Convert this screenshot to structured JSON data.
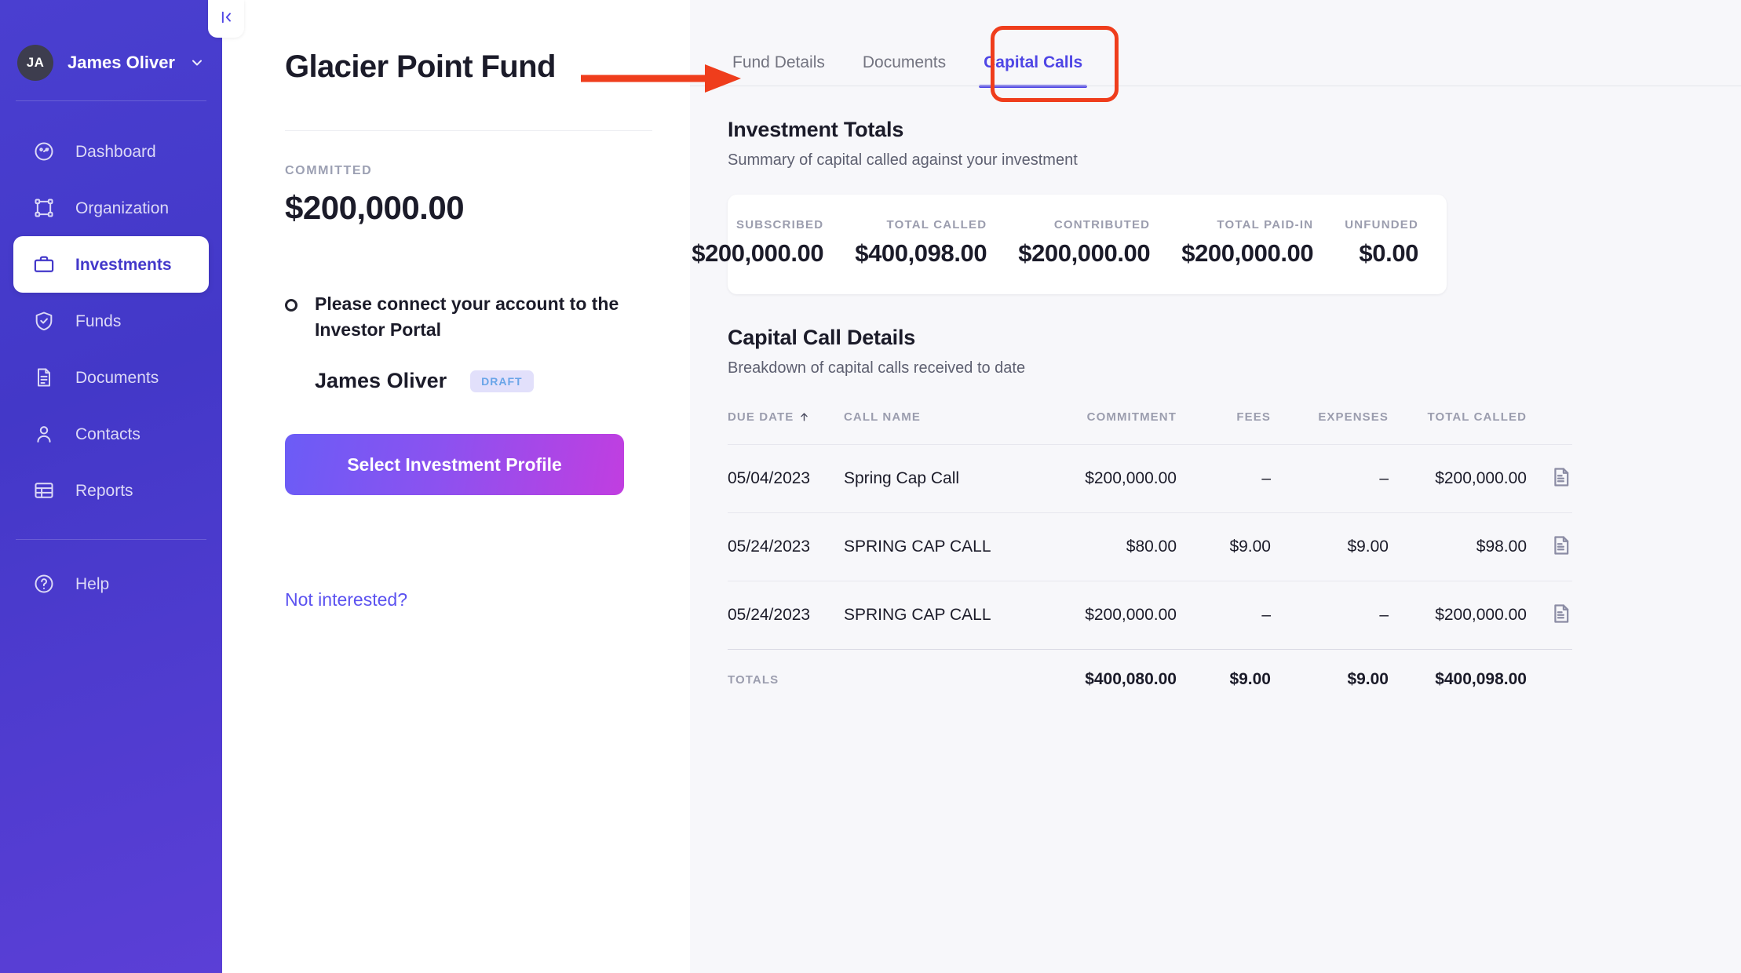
{
  "sidebar": {
    "user": {
      "initials": "JA",
      "name": "James Oliver"
    },
    "items": [
      {
        "label": "Dashboard",
        "icon": "speedometer-icon"
      },
      {
        "label": "Organization",
        "icon": "node-graph-icon"
      },
      {
        "label": "Investments",
        "icon": "briefcase-icon"
      },
      {
        "label": "Funds",
        "icon": "shield-check-icon"
      },
      {
        "label": "Documents",
        "icon": "document-icon"
      },
      {
        "label": "Contacts",
        "icon": "person-icon"
      },
      {
        "label": "Reports",
        "icon": "table-icon"
      }
    ],
    "help": {
      "label": "Help",
      "icon": "question-circle-icon"
    },
    "collapse_icon": "collapse-panel-icon"
  },
  "detail": {
    "fund_title": "Glacier Point Fund",
    "committed_label": "COMMITTED",
    "committed_value": "$200,000.00",
    "notice_text": "Please connect your account to the Investor Portal",
    "profile_name": "James Oliver",
    "profile_badge": "DRAFT",
    "select_profile_label": "Select Investment Profile",
    "not_interested_label": "Not interested?"
  },
  "main": {
    "tabs": [
      {
        "label": "Fund Details",
        "active": false
      },
      {
        "label": "Documents",
        "active": false
      },
      {
        "label": "Capital Calls",
        "active": true
      }
    ],
    "investment_totals": {
      "title": "Investment Totals",
      "subtitle": "Summary of capital called against your investment",
      "cells": [
        {
          "label": "SUBSCRIBED",
          "value": "$200,000.00"
        },
        {
          "label": "TOTAL CALLED",
          "value": "$400,098.00"
        },
        {
          "label": "CONTRIBUTED",
          "value": "$200,000.00"
        },
        {
          "label": "TOTAL PAID-IN",
          "value": "$200,000.00"
        },
        {
          "label": "UNFUNDED",
          "value": "$0.00"
        }
      ]
    },
    "capital_call_details": {
      "title": "Capital Call Details",
      "subtitle": "Breakdown of capital calls received to date",
      "columns": [
        {
          "key": "due_date",
          "label": "DUE DATE",
          "sort": "asc"
        },
        {
          "key": "call_name",
          "label": "CALL NAME"
        },
        {
          "key": "commitment",
          "label": "COMMITMENT"
        },
        {
          "key": "fees",
          "label": "FEES"
        },
        {
          "key": "expenses",
          "label": "EXPENSES"
        },
        {
          "key": "total_called",
          "label": "TOTAL CALLED"
        }
      ],
      "rows": [
        {
          "due_date": "05/04/2023",
          "call_name": "Spring Cap Call",
          "commitment": "$200,000.00",
          "fees": "–",
          "expenses": "–",
          "total_called": "$200,000.00",
          "doc_icon": "document-icon"
        },
        {
          "due_date": "05/24/2023",
          "call_name": "SPRING CAP CALL",
          "commitment": "$80.00",
          "fees": "$9.00",
          "expenses": "$9.00",
          "total_called": "$98.00",
          "doc_icon": "document-icon"
        },
        {
          "due_date": "05/24/2023",
          "call_name": "SPRING CAP CALL",
          "commitment": "$200,000.00",
          "fees": "–",
          "expenses": "–",
          "total_called": "$200,000.00",
          "doc_icon": "document-icon"
        }
      ],
      "totals": {
        "label": "TOTALS",
        "commitment": "$400,080.00",
        "fees": "$9.00",
        "expenses": "$9.00",
        "total_called": "$400,098.00"
      }
    }
  },
  "annotations": {
    "arrow_color": "#ef3d1c",
    "highlight_box_color": "#ef3d1c",
    "highlight_target": "Capital Calls"
  },
  "colors": {
    "sidebar_bg": "#4338c8",
    "accent": "#4f46e5",
    "link": "#5b52f0",
    "button_gradient_start": "#6b5cf6",
    "button_gradient_end": "#c13ee0",
    "badge_bg": "#e2e0fb",
    "badge_text": "#6aa5e8",
    "main_bg": "#f7f7fa"
  }
}
